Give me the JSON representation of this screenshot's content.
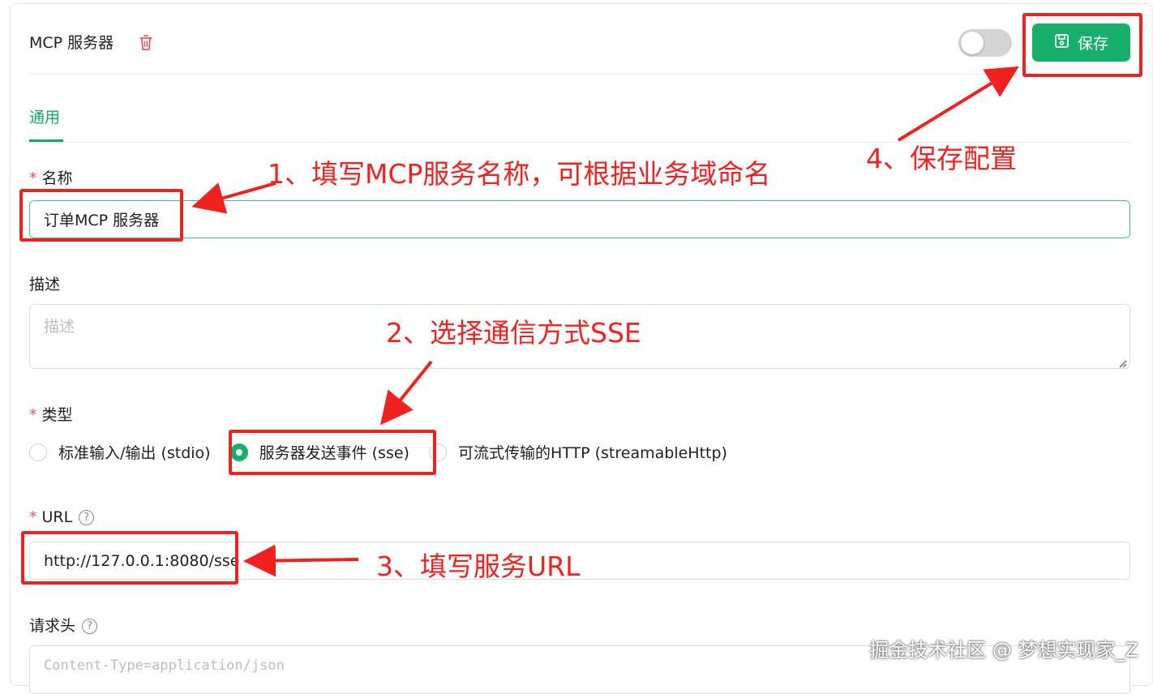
{
  "header": {
    "title": "MCP 服务器",
    "save_label": "保存",
    "toggle_on": false
  },
  "tabs": [
    {
      "label": "通用",
      "active": true
    }
  ],
  "form": {
    "name": {
      "label": "名称",
      "required": true,
      "value": "订单MCP 服务器"
    },
    "description": {
      "label": "描述",
      "required": false,
      "placeholder": "描述",
      "value": ""
    },
    "type": {
      "label": "类型",
      "required": true,
      "options": [
        {
          "label": "标准输入/输出 (stdio)",
          "selected": false
        },
        {
          "label": "服务器发送事件 (sse)",
          "selected": true
        },
        {
          "label": "可流式传输的HTTP (streamableHttp)",
          "selected": false
        }
      ]
    },
    "url": {
      "label": "URL",
      "required": true,
      "value": "http://127.0.0.1:8080/sse"
    },
    "headers": {
      "label": "请求头",
      "placeholder": "Content-Type=application/json"
    }
  },
  "annotations": {
    "step1": "1、填写MCP服务名称，可根据业务域命名",
    "step2": "2、选择通信方式SSE",
    "step3": "3、填写服务URL",
    "step4": "4、保存配置"
  },
  "watermark": "掘金技术社区 @ 梦想实现家_Z",
  "colors": {
    "accent": "#16b06b",
    "annotation": "#f0211e",
    "required": "#e05a5a"
  }
}
